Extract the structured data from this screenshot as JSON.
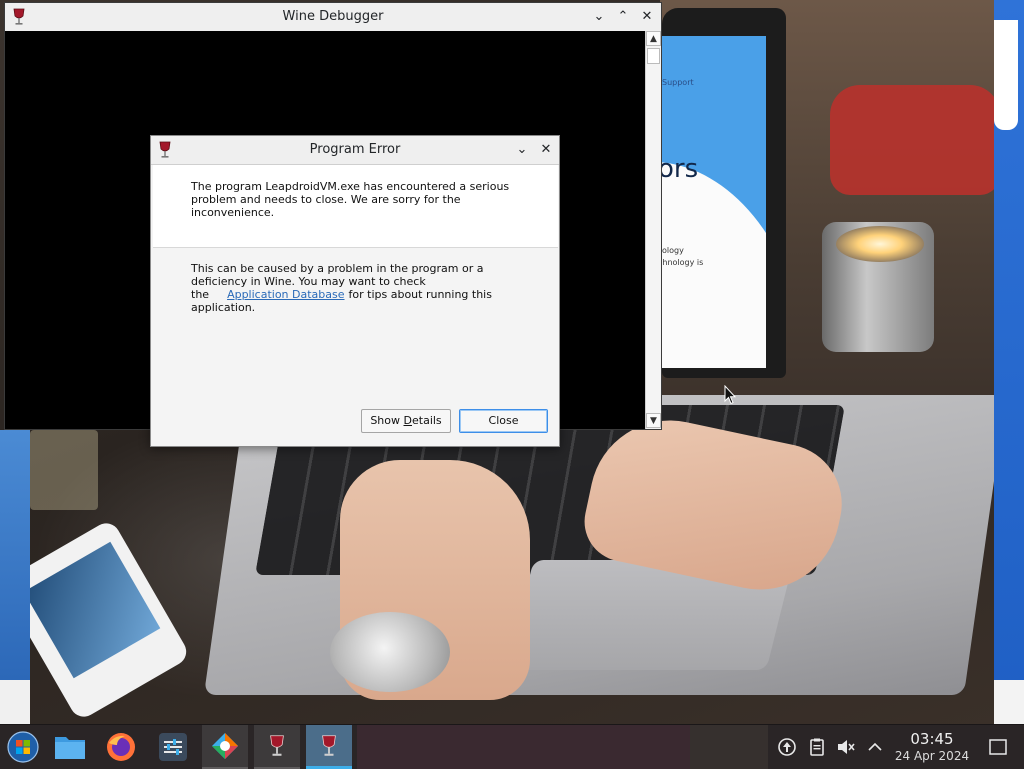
{
  "wine_debugger": {
    "title": "Wine Debugger",
    "controls": {
      "minimize": "⌄",
      "maximize": "⌃",
      "close": "✕"
    },
    "scroll_up": "▲",
    "scroll_down": "▼"
  },
  "program_error": {
    "title": "Program Error",
    "controls": {
      "minimize": "⌄",
      "close": "✕"
    },
    "message": "The program LeapdroidVM.exe has encountered a serious problem and needs to close. We are sorry for the inconvenience.",
    "info_before_link": "This can be caused by a problem in the program or a deficiency in Wine. You may want to check the",
    "link": "Application Database",
    "info_after_link": "for tips about running this application.",
    "show_details_prefix": "Show ",
    "show_details_accel": "D",
    "show_details_suffix": "etails",
    "close_label": "Close"
  },
  "wallpaper": {
    "screen_text_1": "Support",
    "screen_text_2": "ors",
    "screen_text_3": "ology",
    "screen_text_4": "chnology is"
  },
  "taskbar": {
    "items": [
      {
        "name": "start-menu-icon"
      },
      {
        "name": "file-manager-icon"
      },
      {
        "name": "firefox-icon"
      },
      {
        "name": "settings-icon"
      },
      {
        "name": "app-store-icon"
      },
      {
        "name": "wine-icon"
      },
      {
        "name": "wine-icon"
      }
    ],
    "tray": {
      "update_icon": "update-icon",
      "clipboard_icon": "clipboard-icon",
      "volume_icon": "volume-muted-icon",
      "expand_icon": "expand-tray-icon"
    },
    "clock_time": "03:45",
    "clock_date": "24 Apr 2024"
  },
  "colors": {
    "accent": "#3daee9",
    "link": "#2a6ab8",
    "taskbar": "#2a2526",
    "wine_red": "#a3182a"
  }
}
